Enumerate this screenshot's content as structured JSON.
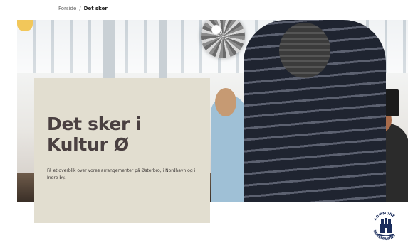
{
  "breadcrumb": {
    "home": "Forside",
    "separator": "/",
    "current": "Det sker"
  },
  "hero": {
    "title": "Det sker i Kultur Ø",
    "description": "Få et overblik over vores arrangementer på Østerbro, i Nordhavn og i Indre by.",
    "image_alt": "People dancing in a bright hall under a disco ball"
  },
  "logo": {
    "name": "Københavns Kommune",
    "icon": "kobenhavns-kommune-logo-icon"
  },
  "colors": {
    "card_background": "#e2ded0",
    "title_color": "#4a4041",
    "brand_blue": "#1b2d5c"
  }
}
